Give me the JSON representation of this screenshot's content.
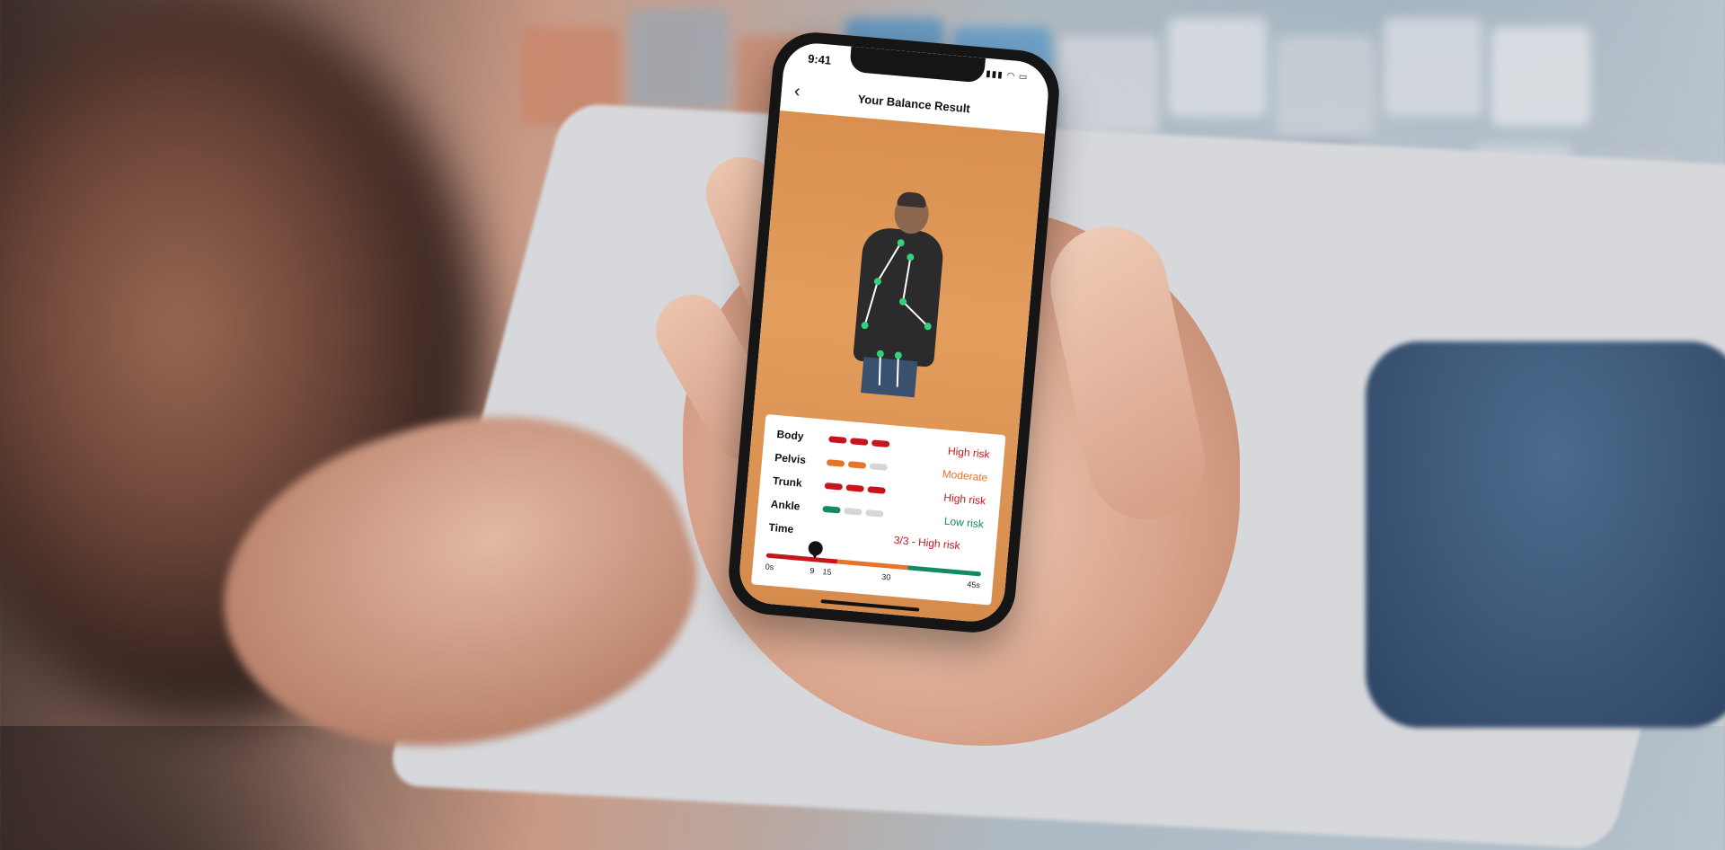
{
  "status": {
    "time": "9:41"
  },
  "nav": {
    "title": "Your Balance Result",
    "back_icon": "chevron-left-icon"
  },
  "results": [
    {
      "label": "Body",
      "level": 3,
      "risk": "High risk",
      "color": "#c4161c"
    },
    {
      "label": "Pelvis",
      "level": 2,
      "risk": "Moderate",
      "color": "#e6742a"
    },
    {
      "label": "Trunk",
      "level": 3,
      "risk": "High risk",
      "color": "#c4161c"
    },
    {
      "label": "Ankle",
      "level": 1,
      "risk": "Low risk",
      "color": "#148a63"
    },
    {
      "label": "Time",
      "level": null,
      "risk": "3/3 - High risk",
      "color": "#c4161c"
    }
  ],
  "timeline": {
    "marker_value": 9,
    "labels": [
      "0s",
      "9",
      "15",
      "30",
      "45s"
    ],
    "colors": {
      "high": "#c4161c",
      "moderate": "#e6742a",
      "low": "#148a63"
    }
  }
}
